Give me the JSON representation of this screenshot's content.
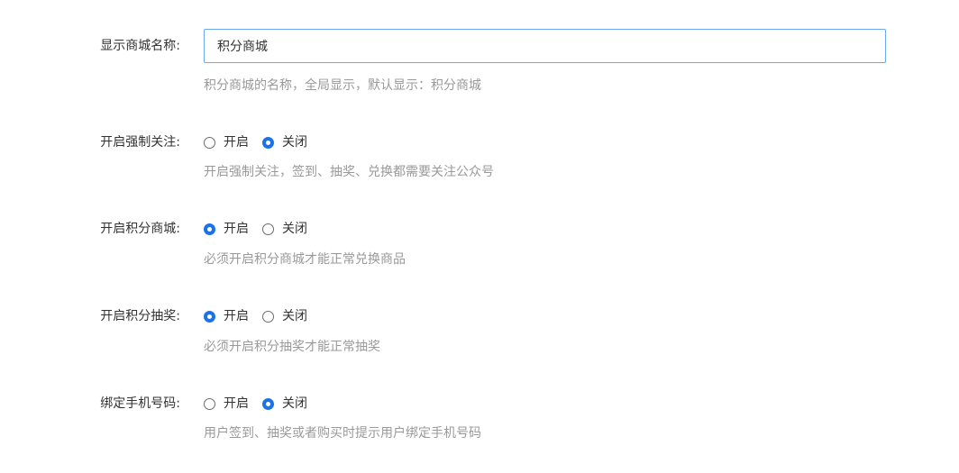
{
  "fields": [
    {
      "label": "显示商城名称:",
      "type": "text",
      "value": "积分商城",
      "help": "积分商城的名称，全局显示，默认显示：积分商城"
    },
    {
      "label": "开启强制关注:",
      "type": "radio",
      "options": [
        "开启",
        "关闭"
      ],
      "selected": "关闭",
      "help": "开启强制关注，签到、抽奖、兑换都需要关注公众号"
    },
    {
      "label": "开启积分商城:",
      "type": "radio",
      "options": [
        "开启",
        "关闭"
      ],
      "selected": "开启",
      "help": "必须开启积分商城才能正常兑换商品"
    },
    {
      "label": "开启积分抽奖:",
      "type": "radio",
      "options": [
        "开启",
        "关闭"
      ],
      "selected": "开启",
      "help": "必须开启积分抽奖才能正常抽奖"
    },
    {
      "label": "绑定手机号码:",
      "type": "radio",
      "options": [
        "开启",
        "关闭"
      ],
      "selected": "关闭",
      "help": "用户签到、抽奖或者购买时提示用户绑定手机号码"
    }
  ],
  "colors": {
    "accent": "#1a73e8",
    "input_border": "#6aa8f0",
    "help_text": "#999999",
    "label_text": "#333333"
  }
}
